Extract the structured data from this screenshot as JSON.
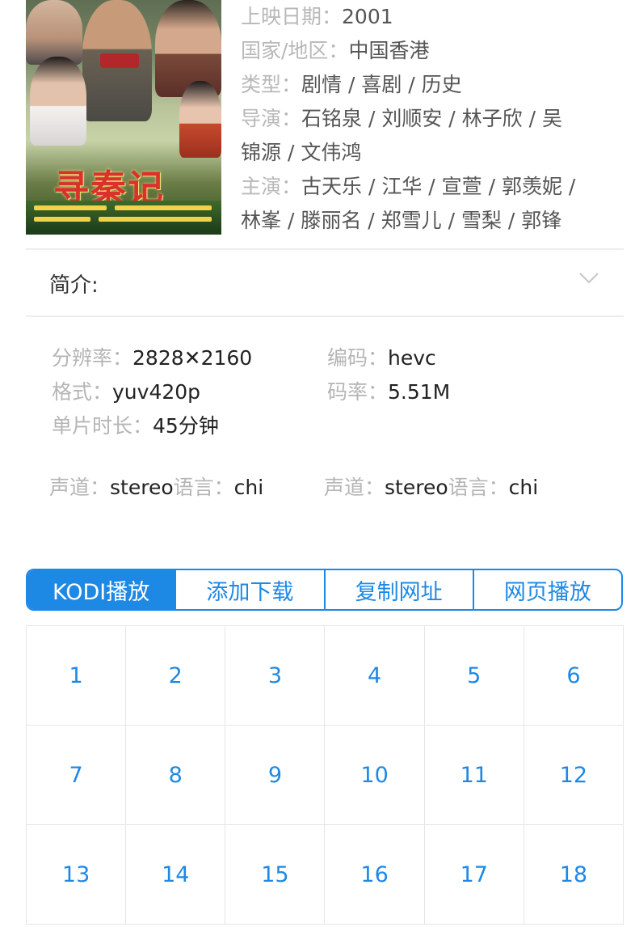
{
  "info": {
    "release_label": "上映日期：",
    "release_value": "2001",
    "region_label": "国家/地区：",
    "region_value": "中国香港",
    "genre_label": "类型：",
    "genre_value": "剧情 / 喜剧 / 历史",
    "director_label": "导演：",
    "director_value_line1": "石铭泉 / 刘顺安 / 林子欣 / 吴",
    "director_value_line2": "锦源 / 文伟鸿",
    "cast_label": "主演：",
    "cast_value_line1": "古天乐 / 江华 / 宣萱 / 郭羡妮 /",
    "cast_value_line2": "林峯 / 滕丽名 / 郑雪儿 / 雪梨 / 郭锋"
  },
  "poster": {
    "title_art": "寻秦记"
  },
  "intro": {
    "label": "简介:",
    "chevron_icon": "chevron-down-icon"
  },
  "media": {
    "resolution_label": "分辨率：",
    "resolution_value": "2828✕2160",
    "codec_label": "编码：",
    "codec_value": "hevc",
    "format_label": "格式：",
    "format_value": "yuv420p",
    "bitrate_label": "码率：",
    "bitrate_value": "5.51M",
    "duration_label": "单片时长：",
    "duration_value": "45分钟",
    "audio": [
      {
        "channel_label": "声道：",
        "channel_value": "stereo",
        "lang_label": "语言：",
        "lang_value": "chi"
      },
      {
        "channel_label": "声道：",
        "channel_value": "stereo",
        "lang_label": "语言：",
        "lang_value": "chi"
      }
    ]
  },
  "actions": {
    "kodi": "KODI播放",
    "download": "添加下载",
    "copy": "复制网址",
    "web": "网页播放",
    "accent": "#1e88e5"
  },
  "episodes": [
    "1",
    "2",
    "3",
    "4",
    "5",
    "6",
    "7",
    "8",
    "9",
    "10",
    "11",
    "12",
    "13",
    "14",
    "15",
    "16",
    "17",
    "18"
  ]
}
